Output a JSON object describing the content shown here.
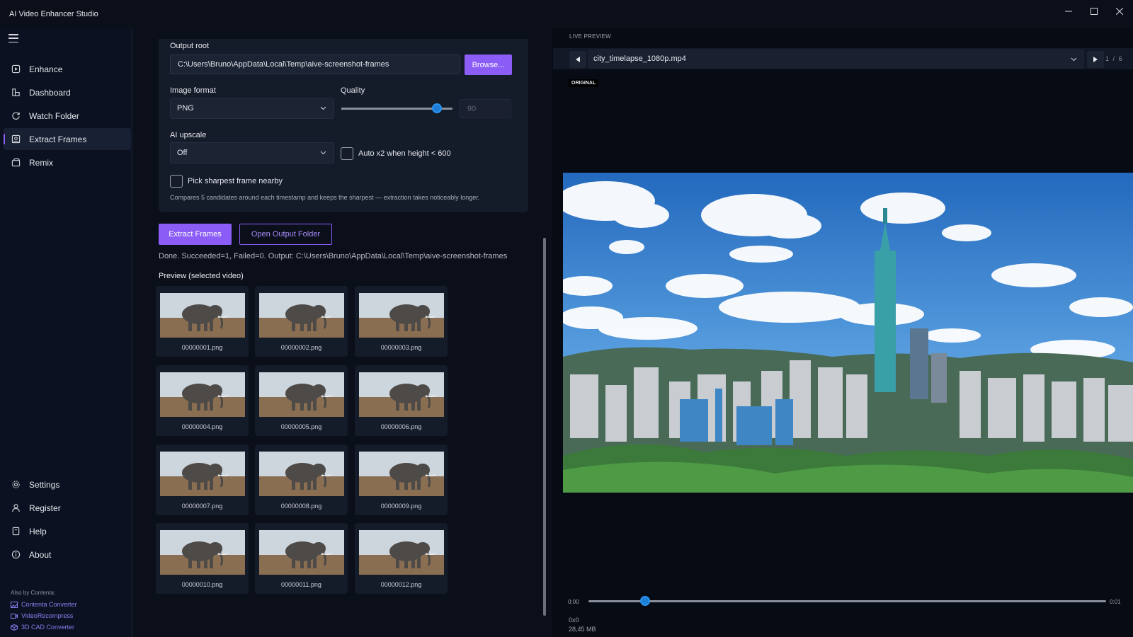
{
  "app": {
    "title": "AI Video Enhancer Studio"
  },
  "sidebar": {
    "items": [
      {
        "label": "Enhance",
        "icon": "enhance-icon"
      },
      {
        "label": "Dashboard",
        "icon": "dashboard-icon"
      },
      {
        "label": "Watch Folder",
        "icon": "watch-folder-icon"
      },
      {
        "label": "Extract Frames",
        "icon": "extract-frames-icon",
        "active": true
      },
      {
        "label": "Remix",
        "icon": "remix-icon"
      }
    ],
    "bottom_items": [
      {
        "label": "Settings",
        "icon": "gear-icon"
      },
      {
        "label": "Register",
        "icon": "user-icon"
      },
      {
        "label": "Help",
        "icon": "help-book-icon"
      },
      {
        "label": "About",
        "icon": "info-icon"
      }
    ],
    "also_label": "Also by Contenta:",
    "also_links": [
      {
        "label": "Contenta Converter",
        "icon": "image-icon"
      },
      {
        "label": "VideoRecompress",
        "icon": "video-icon"
      },
      {
        "label": "3D CAD Converter",
        "icon": "cube-icon"
      }
    ]
  },
  "form": {
    "output_root_label": "Output root",
    "output_root_value": "C:\\Users\\Bruno\\AppData\\Local\\Temp\\aive-screenshot-frames",
    "browse_label": "Browse...",
    "image_format_label": "Image format",
    "image_format_value": "PNG",
    "quality_label": "Quality",
    "quality_value": "90",
    "quality_slider_fraction": 0.86,
    "ai_upscale_label": "AI upscale",
    "ai_upscale_value": "Off",
    "auto_x2_label": "Auto x2 when height < 600",
    "auto_x2_checked": false,
    "sharpest_label": "Pick sharpest frame nearby",
    "sharpest_checked": false,
    "sharpest_help": "Compares 5 candidates around each timestamp and keeps the sharpest — extraction takes noticeably longer."
  },
  "actions": {
    "extract_label": "Extract Frames",
    "open_folder_label": "Open Output Folder"
  },
  "status": "Done. Succeeded=1, Failed=0. Output: C:\\Users\\Bruno\\AppData\\Local\\Temp\\aive-screenshot-frames",
  "preview_section": {
    "title": "Preview (selected video)",
    "frames": [
      "00000001.png",
      "00000002.png",
      "00000003.png",
      "00000004.png",
      "00000005.png",
      "00000006.png",
      "00000007.png",
      "00000008.png",
      "00000009.png",
      "00000010.png",
      "00000011.png",
      "00000012.png"
    ]
  },
  "live_preview": {
    "label": "LIVE PREVIEW",
    "file": "city_timelapse_1080p.mp4",
    "counter_current": "1",
    "counter_sep": "/",
    "counter_total": "6",
    "badge": "ORIGINAL",
    "time_start": "0:00",
    "time_end": "0:01",
    "seek_fraction": 0.11,
    "resolution": "0x0",
    "size": "28,45 MB"
  },
  "colors": {
    "accent": "#8b5cf6",
    "slider": "#1f7fd6",
    "background": "#0a0f1a"
  }
}
